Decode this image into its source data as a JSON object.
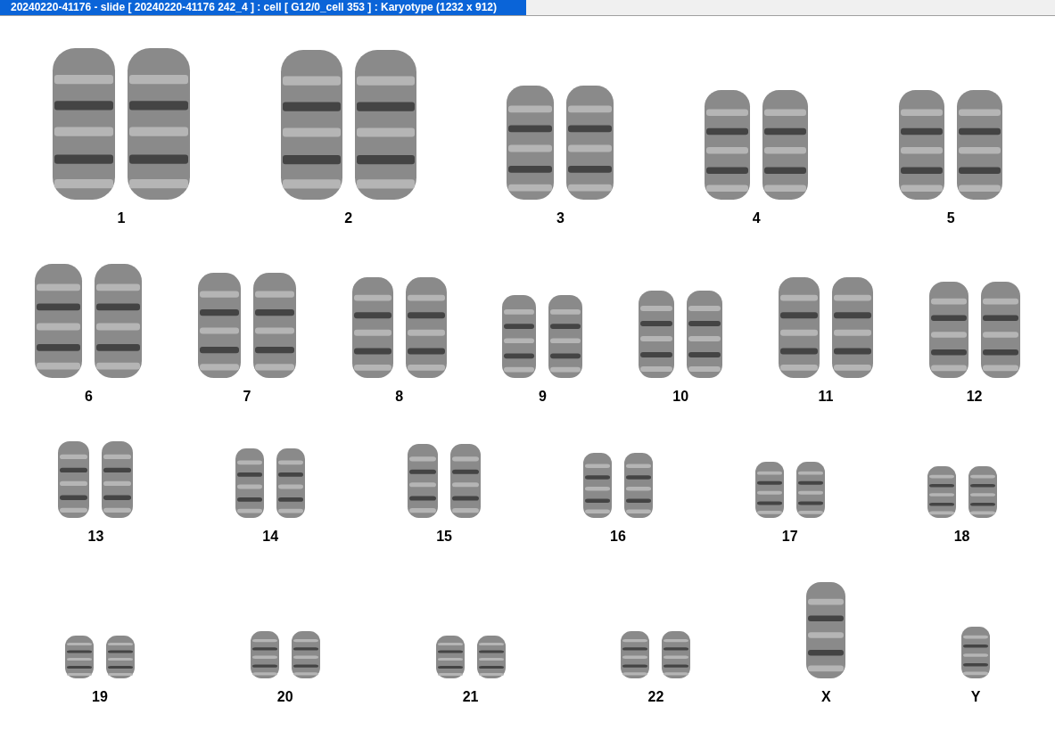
{
  "window": {
    "title": "20240220-41176 - slide [ 20240220-41176 242_4 ] : cell [ G12/0_cell 353 ] : Karyotype  (1232 x 912)"
  },
  "rows": [
    {
      "groups": [
        {
          "label": "1",
          "kind": "pair"
        },
        {
          "label": "2",
          "kind": "pair"
        },
        {
          "label": "3",
          "kind": "pair"
        },
        {
          "label": "4",
          "kind": "pair"
        },
        {
          "label": "5",
          "kind": "pair"
        }
      ]
    },
    {
      "groups": [
        {
          "label": "6",
          "kind": "pair"
        },
        {
          "label": "7",
          "kind": "pair"
        },
        {
          "label": "8",
          "kind": "pair"
        },
        {
          "label": "9",
          "kind": "pair"
        },
        {
          "label": "10",
          "kind": "pair"
        },
        {
          "label": "11",
          "kind": "pair"
        },
        {
          "label": "12",
          "kind": "pair"
        }
      ]
    },
    {
      "groups": [
        {
          "label": "13",
          "kind": "pair"
        },
        {
          "label": "14",
          "kind": "pair"
        },
        {
          "label": "15",
          "kind": "pair"
        },
        {
          "label": "16",
          "kind": "pair"
        },
        {
          "label": "17",
          "kind": "pair"
        },
        {
          "label": "18",
          "kind": "pair"
        }
      ]
    },
    {
      "groups": [
        {
          "label": "19",
          "kind": "pair"
        },
        {
          "label": "20",
          "kind": "pair"
        },
        {
          "label": "21",
          "kind": "pair"
        },
        {
          "label": "22",
          "kind": "pair"
        },
        {
          "label": "X",
          "kind": "single"
        },
        {
          "label": "Y",
          "kind": "single"
        }
      ]
    }
  ]
}
